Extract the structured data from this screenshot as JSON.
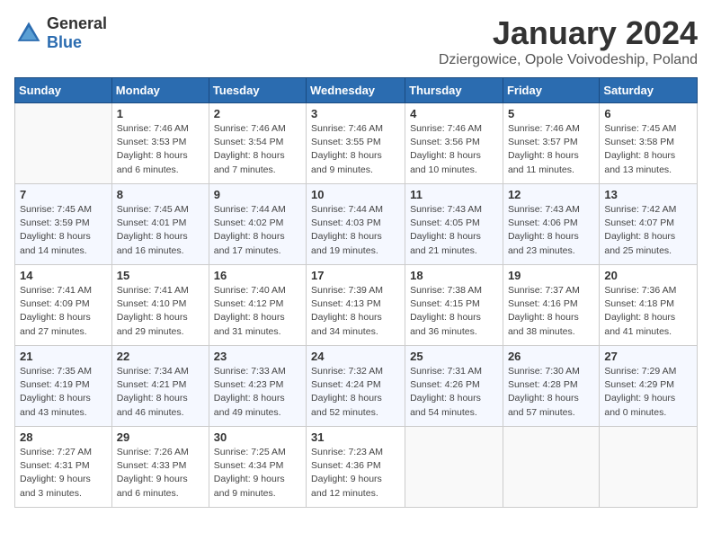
{
  "header": {
    "logo_general": "General",
    "logo_blue": "Blue",
    "title": "January 2024",
    "subtitle": "Dziergowice, Opole Voivodeship, Poland"
  },
  "columns": [
    "Sunday",
    "Monday",
    "Tuesday",
    "Wednesday",
    "Thursday",
    "Friday",
    "Saturday"
  ],
  "weeks": [
    [
      {
        "day": "",
        "sunrise": "",
        "sunset": "",
        "daylight": ""
      },
      {
        "day": "1",
        "sunrise": "Sunrise: 7:46 AM",
        "sunset": "Sunset: 3:53 PM",
        "daylight": "Daylight: 8 hours and 6 minutes."
      },
      {
        "day": "2",
        "sunrise": "Sunrise: 7:46 AM",
        "sunset": "Sunset: 3:54 PM",
        "daylight": "Daylight: 8 hours and 7 minutes."
      },
      {
        "day": "3",
        "sunrise": "Sunrise: 7:46 AM",
        "sunset": "Sunset: 3:55 PM",
        "daylight": "Daylight: 8 hours and 9 minutes."
      },
      {
        "day": "4",
        "sunrise": "Sunrise: 7:46 AM",
        "sunset": "Sunset: 3:56 PM",
        "daylight": "Daylight: 8 hours and 10 minutes."
      },
      {
        "day": "5",
        "sunrise": "Sunrise: 7:46 AM",
        "sunset": "Sunset: 3:57 PM",
        "daylight": "Daylight: 8 hours and 11 minutes."
      },
      {
        "day": "6",
        "sunrise": "Sunrise: 7:45 AM",
        "sunset": "Sunset: 3:58 PM",
        "daylight": "Daylight: 8 hours and 13 minutes."
      }
    ],
    [
      {
        "day": "7",
        "sunrise": "Sunrise: 7:45 AM",
        "sunset": "Sunset: 3:59 PM",
        "daylight": "Daylight: 8 hours and 14 minutes."
      },
      {
        "day": "8",
        "sunrise": "Sunrise: 7:45 AM",
        "sunset": "Sunset: 4:01 PM",
        "daylight": "Daylight: 8 hours and 16 minutes."
      },
      {
        "day": "9",
        "sunrise": "Sunrise: 7:44 AM",
        "sunset": "Sunset: 4:02 PM",
        "daylight": "Daylight: 8 hours and 17 minutes."
      },
      {
        "day": "10",
        "sunrise": "Sunrise: 7:44 AM",
        "sunset": "Sunset: 4:03 PM",
        "daylight": "Daylight: 8 hours and 19 minutes."
      },
      {
        "day": "11",
        "sunrise": "Sunrise: 7:43 AM",
        "sunset": "Sunset: 4:05 PM",
        "daylight": "Daylight: 8 hours and 21 minutes."
      },
      {
        "day": "12",
        "sunrise": "Sunrise: 7:43 AM",
        "sunset": "Sunset: 4:06 PM",
        "daylight": "Daylight: 8 hours and 23 minutes."
      },
      {
        "day": "13",
        "sunrise": "Sunrise: 7:42 AM",
        "sunset": "Sunset: 4:07 PM",
        "daylight": "Daylight: 8 hours and 25 minutes."
      }
    ],
    [
      {
        "day": "14",
        "sunrise": "Sunrise: 7:41 AM",
        "sunset": "Sunset: 4:09 PM",
        "daylight": "Daylight: 8 hours and 27 minutes."
      },
      {
        "day": "15",
        "sunrise": "Sunrise: 7:41 AM",
        "sunset": "Sunset: 4:10 PM",
        "daylight": "Daylight: 8 hours and 29 minutes."
      },
      {
        "day": "16",
        "sunrise": "Sunrise: 7:40 AM",
        "sunset": "Sunset: 4:12 PM",
        "daylight": "Daylight: 8 hours and 31 minutes."
      },
      {
        "day": "17",
        "sunrise": "Sunrise: 7:39 AM",
        "sunset": "Sunset: 4:13 PM",
        "daylight": "Daylight: 8 hours and 34 minutes."
      },
      {
        "day": "18",
        "sunrise": "Sunrise: 7:38 AM",
        "sunset": "Sunset: 4:15 PM",
        "daylight": "Daylight: 8 hours and 36 minutes."
      },
      {
        "day": "19",
        "sunrise": "Sunrise: 7:37 AM",
        "sunset": "Sunset: 4:16 PM",
        "daylight": "Daylight: 8 hours and 38 minutes."
      },
      {
        "day": "20",
        "sunrise": "Sunrise: 7:36 AM",
        "sunset": "Sunset: 4:18 PM",
        "daylight": "Daylight: 8 hours and 41 minutes."
      }
    ],
    [
      {
        "day": "21",
        "sunrise": "Sunrise: 7:35 AM",
        "sunset": "Sunset: 4:19 PM",
        "daylight": "Daylight: 8 hours and 43 minutes."
      },
      {
        "day": "22",
        "sunrise": "Sunrise: 7:34 AM",
        "sunset": "Sunset: 4:21 PM",
        "daylight": "Daylight: 8 hours and 46 minutes."
      },
      {
        "day": "23",
        "sunrise": "Sunrise: 7:33 AM",
        "sunset": "Sunset: 4:23 PM",
        "daylight": "Daylight: 8 hours and 49 minutes."
      },
      {
        "day": "24",
        "sunrise": "Sunrise: 7:32 AM",
        "sunset": "Sunset: 4:24 PM",
        "daylight": "Daylight: 8 hours and 52 minutes."
      },
      {
        "day": "25",
        "sunrise": "Sunrise: 7:31 AM",
        "sunset": "Sunset: 4:26 PM",
        "daylight": "Daylight: 8 hours and 54 minutes."
      },
      {
        "day": "26",
        "sunrise": "Sunrise: 7:30 AM",
        "sunset": "Sunset: 4:28 PM",
        "daylight": "Daylight: 8 hours and 57 minutes."
      },
      {
        "day": "27",
        "sunrise": "Sunrise: 7:29 AM",
        "sunset": "Sunset: 4:29 PM",
        "daylight": "Daylight: 9 hours and 0 minutes."
      }
    ],
    [
      {
        "day": "28",
        "sunrise": "Sunrise: 7:27 AM",
        "sunset": "Sunset: 4:31 PM",
        "daylight": "Daylight: 9 hours and 3 minutes."
      },
      {
        "day": "29",
        "sunrise": "Sunrise: 7:26 AM",
        "sunset": "Sunset: 4:33 PM",
        "daylight": "Daylight: 9 hours and 6 minutes."
      },
      {
        "day": "30",
        "sunrise": "Sunrise: 7:25 AM",
        "sunset": "Sunset: 4:34 PM",
        "daylight": "Daylight: 9 hours and 9 minutes."
      },
      {
        "day": "31",
        "sunrise": "Sunrise: 7:23 AM",
        "sunset": "Sunset: 4:36 PM",
        "daylight": "Daylight: 9 hours and 12 minutes."
      },
      {
        "day": "",
        "sunrise": "",
        "sunset": "",
        "daylight": ""
      },
      {
        "day": "",
        "sunrise": "",
        "sunset": "",
        "daylight": ""
      },
      {
        "day": "",
        "sunrise": "",
        "sunset": "",
        "daylight": ""
      }
    ]
  ]
}
